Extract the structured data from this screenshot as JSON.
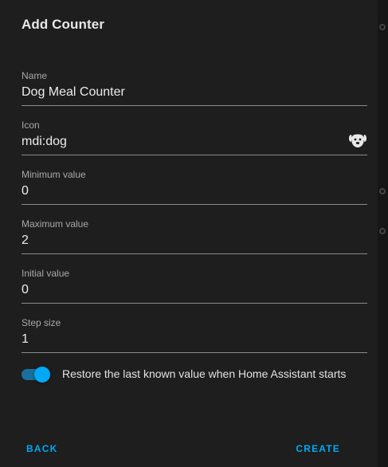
{
  "dialog": {
    "title": "Add Counter"
  },
  "fields": {
    "name": {
      "label": "Name",
      "value": "Dog Meal Counter"
    },
    "icon": {
      "label": "Icon",
      "value": "mdi:dog",
      "preview_icon": "dog-icon"
    },
    "minimum": {
      "label": "Minimum value",
      "value": "0"
    },
    "maximum": {
      "label": "Maximum value",
      "value": "2"
    },
    "initial": {
      "label": "Initial value",
      "value": "0"
    },
    "step": {
      "label": "Step size",
      "value": "1"
    }
  },
  "restore": {
    "label": "Restore the last known value when Home Assistant starts",
    "checked": true
  },
  "actions": {
    "back_label": "BACK",
    "create_label": "CREATE"
  },
  "colors": {
    "accent": "#03a9f4",
    "surface": "#1e1e1e",
    "divider": "#8a8a8a"
  }
}
